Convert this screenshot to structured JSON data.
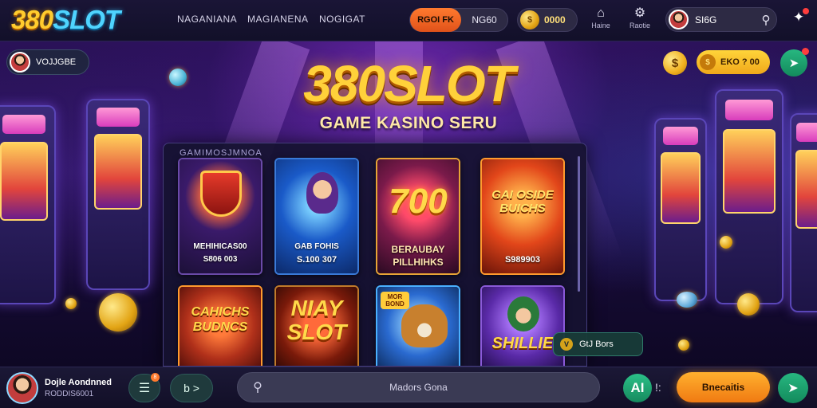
{
  "header": {
    "logo_num": "380",
    "logo_text": "SLOT",
    "nav": [
      "NAGANIANA",
      "MAGIANENA",
      "NOGIGAT"
    ],
    "promo_label": "RGOI FK",
    "promo_value": "NG60",
    "balance": "0000",
    "icon_1_label": "Haine",
    "icon_2_label": "Raotie",
    "username": "SI6G"
  },
  "overlay": {
    "user_chip_name": "VOJJGBE",
    "gold_pill_text": "EKO ? 00",
    "floating_chip_text": "GtJ Bors"
  },
  "hero": {
    "title": "380SLOT",
    "subtitle": "GAME KASINO SERU"
  },
  "panel": {
    "title": "GAMIMOSJMNOA",
    "games": [
      {
        "line1": "MEHIHICAS00",
        "line2": "S806 003"
      },
      {
        "line1": "GAB FOHIS",
        "line2": "S.100 307"
      },
      {
        "big": "700",
        "line1": "BERAUBAY",
        "line2": "PILLHIHKS"
      },
      {
        "big": "GAI OSIDE BUICHS",
        "line2": "S989903"
      },
      {
        "big": "CAHICHS BUDNCS"
      },
      {
        "big": "NIAY SLOT"
      },
      {
        "badge": "MOR BOND"
      },
      {
        "big": "SHILLIE"
      }
    ]
  },
  "bottom": {
    "user_name": "Dojle Aondnned",
    "user_id": "RODDIS6001",
    "icon_badge": "8",
    "round_2_label": "b >",
    "search_placeholder": "Madors Gona",
    "green_label": "AI",
    "hash_label": "!:",
    "cta_label": "Bnecaitis"
  },
  "colors": {
    "accent_gold": "#ffd13a",
    "accent_orange": "#f07a12",
    "accent_green": "#27b780",
    "bg_dark": "#120a2a"
  }
}
